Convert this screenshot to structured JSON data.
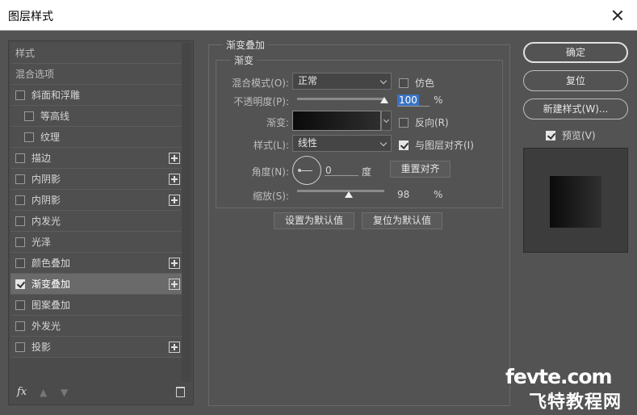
{
  "window": {
    "title": "图层样式"
  },
  "sidebar": {
    "items": [
      {
        "label": "样式",
        "type": "header"
      },
      {
        "label": "混合选项",
        "type": "header"
      },
      {
        "label": "斜面和浮雕",
        "checked": false,
        "plus": false,
        "indent": false
      },
      {
        "label": "等高线",
        "checked": false,
        "plus": false,
        "indent": true
      },
      {
        "label": "纹理",
        "checked": false,
        "plus": false,
        "indent": true
      },
      {
        "label": "描边",
        "checked": false,
        "plus": true,
        "indent": false
      },
      {
        "label": "内阴影",
        "checked": false,
        "plus": true,
        "indent": false
      },
      {
        "label": "内阴影",
        "checked": false,
        "plus": true,
        "indent": false
      },
      {
        "label": "内发光",
        "checked": false,
        "plus": false,
        "indent": false
      },
      {
        "label": "光泽",
        "checked": false,
        "plus": false,
        "indent": false
      },
      {
        "label": "颜色叠加",
        "checked": false,
        "plus": true,
        "indent": false
      },
      {
        "label": "渐变叠加",
        "checked": true,
        "plus": true,
        "indent": false,
        "selected": true
      },
      {
        "label": "图案叠加",
        "checked": false,
        "plus": false,
        "indent": false
      },
      {
        "label": "外发光",
        "checked": false,
        "plus": false,
        "indent": false
      },
      {
        "label": "投影",
        "checked": false,
        "plus": true,
        "indent": false
      }
    ],
    "footer": {
      "fx_label": "fx"
    }
  },
  "main": {
    "section_title": "渐变叠加",
    "group_title": "渐变",
    "blend_mode_label": "混合模式(O):",
    "blend_mode_value": "正常",
    "dither_label": "仿色",
    "opacity_label": "不透明度(P):",
    "opacity_value": "100",
    "opacity_unit": "%",
    "opacity_level": 100,
    "gradient_label": "渐变:",
    "reverse_label": "反向(R)",
    "style_label": "样式(L):",
    "style_value": "线性",
    "align_label": "与图层对齐(I)",
    "align_checked": true,
    "angle_label": "角度(N):",
    "angle_value": "0",
    "angle_unit": "度",
    "reset_align_label": "重置对齐",
    "scale_label": "缩放(S):",
    "scale_value": "98",
    "scale_unit": "%",
    "set_default_label": "设置为默认值",
    "reset_default_label": "复位为默认值"
  },
  "right": {
    "ok_label": "确定",
    "reset_label": "复位",
    "new_style_label": "新建样式(W)...",
    "preview_label": "预览(V)",
    "preview_checked": true
  },
  "watermark": {
    "line1_a": "fevte",
    "line1_b": ".com",
    "line2": "飞特教程网"
  },
  "colors": {
    "panel_bg": "#535353",
    "highlight": "#3b73c4"
  }
}
